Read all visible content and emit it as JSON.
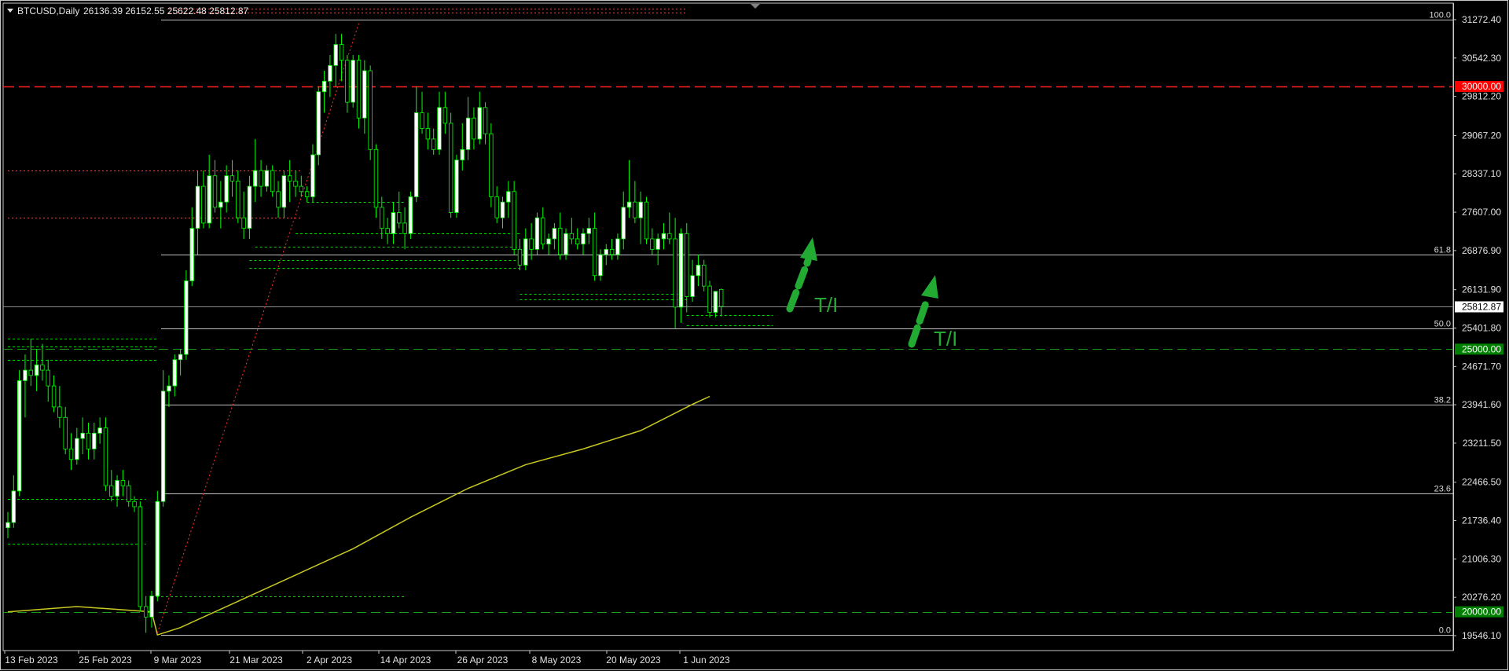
{
  "window": {
    "symbol_header": "BTCUSD,Daily",
    "ohlc_header": "26136.39 26152.55 25622.48 25812.87",
    "dropdown_icon": "triangle-down-icon"
  },
  "colors": {
    "background": "#000000",
    "frame": "#c8c8c8",
    "bull_candle": "#ffffff",
    "bear_candle": "#000000",
    "candle_outline": "#00ff00",
    "fib_lines": "#c0c0c0",
    "support_dashes": "#00ff00",
    "resistance_dashes": "#ff4040",
    "moving_average": "#c8c820",
    "arrows": "#22aa33",
    "price_label_red": "#ff0000",
    "price_label_green": "#008000",
    "current_price_label": "#ffffff"
  },
  "chart_data": {
    "type": "candlestick",
    "symbol": "BTCUSD",
    "timeframe": "Daily",
    "ylim": [
      19300,
      31500
    ],
    "y_ticks": [
      "31272.40",
      "30542.30",
      "29812.20",
      "29067.20",
      "28337.10",
      "27607.00",
      "26876.90",
      "26131.90",
      "25401.80",
      "24671.70",
      "23941.60",
      "23211.50",
      "22466.50",
      "21736.40",
      "21006.30",
      "20276.20",
      "19546.10"
    ],
    "x_ticks": [
      "13 Feb 2023",
      "25 Feb 2023",
      "9 Mar 2023",
      "21 Mar 2023",
      "2 Apr 2023",
      "14 Apr 2023",
      "26 Apr 2023",
      "8 May 2023",
      "20 May 2023",
      "1 Jun 2023"
    ],
    "current_price": "25812.87",
    "price_labels": [
      {
        "text": "30000.00",
        "price": 30000,
        "color": "red"
      },
      {
        "text": "25000.00",
        "price": 25000,
        "color": "green"
      },
      {
        "text": "20000.00",
        "price": 20000,
        "color": "green"
      }
    ],
    "fibonacci": {
      "high": 31270,
      "low": 19560,
      "levels": [
        {
          "label": "100.0",
          "price": 31270
        },
        {
          "label": "61.8",
          "price": 26800
        },
        {
          "label": "50.0",
          "price": 25400
        },
        {
          "label": "38.2",
          "price": 23950
        },
        {
          "label": "23.6",
          "price": 22250
        },
        {
          "label": "0.0",
          "price": 19560
        }
      ]
    },
    "horizontal_levels": [
      30000,
      25000,
      20000
    ],
    "annotations": [
      "T/I",
      "T/I"
    ],
    "candles": [
      [
        21600,
        21900,
        21400,
        21700
      ],
      [
        21700,
        22600,
        21600,
        22300
      ],
      [
        22300,
        24600,
        22200,
        24400
      ],
      [
        24400,
        24900,
        23700,
        24600
      ],
      [
        24600,
        25200,
        24300,
        24500
      ],
      [
        24500,
        25000,
        24200,
        24700
      ],
      [
        24700,
        25100,
        24400,
        24600
      ],
      [
        24600,
        24800,
        24000,
        24300
      ],
      [
        24300,
        24500,
        23800,
        23900
      ],
      [
        23900,
        24300,
        23500,
        23700
      ],
      [
        23700,
        23900,
        23000,
        23100
      ],
      [
        23100,
        23400,
        22700,
        22900
      ],
      [
        22900,
        23500,
        22800,
        23300
      ],
      [
        23300,
        23700,
        23000,
        23400
      ],
      [
        23400,
        23600,
        22900,
        23100
      ],
      [
        23100,
        23600,
        22900,
        23400
      ],
      [
        23400,
        23700,
        23200,
        23500
      ],
      [
        23500,
        23700,
        22300,
        22400
      ],
      [
        22400,
        22700,
        22100,
        22200
      ],
      [
        22200,
        22600,
        22000,
        22500
      ],
      [
        22500,
        22700,
        22200,
        22400
      ],
      [
        22400,
        22500,
        22000,
        22100
      ],
      [
        22100,
        22200,
        21900,
        22000
      ],
      [
        22000,
        22100,
        20000,
        20100
      ],
      [
        20100,
        20300,
        19600,
        19900
      ],
      [
        19900,
        20400,
        19700,
        20300
      ],
      [
        20300,
        22300,
        20200,
        22100
      ],
      [
        22100,
        24600,
        22000,
        24200
      ],
      [
        24200,
        24500,
        23900,
        24300
      ],
      [
        24300,
        24900,
        24100,
        24800
      ],
      [
        24800,
        25000,
        24500,
        24900
      ],
      [
        24900,
        26500,
        24800,
        26300
      ],
      [
        26300,
        27700,
        26200,
        27300
      ],
      [
        27300,
        28400,
        26800,
        28100
      ],
      [
        28100,
        28400,
        27300,
        27400
      ],
      [
        27400,
        28700,
        27300,
        28300
      ],
      [
        28300,
        28600,
        27600,
        27700
      ],
      [
        27700,
        28200,
        27300,
        27800
      ],
      [
        27800,
        28500,
        27600,
        28300
      ],
      [
        28300,
        28600,
        27900,
        28200
      ],
      [
        28200,
        28400,
        27400,
        27500
      ],
      [
        27500,
        28000,
        27100,
        27300
      ],
      [
        27300,
        28300,
        27100,
        28100
      ],
      [
        28100,
        29000,
        27800,
        28400
      ],
      [
        28400,
        28600,
        27900,
        28100
      ],
      [
        28100,
        28500,
        28000,
        28400
      ],
      [
        28400,
        28500,
        27900,
        28000
      ],
      [
        28000,
        28200,
        27500,
        27700
      ],
      [
        27700,
        28400,
        27500,
        28300
      ],
      [
        28300,
        28600,
        27800,
        28200
      ],
      [
        28200,
        28400,
        27900,
        28100
      ],
      [
        28100,
        28300,
        27900,
        28000
      ],
      [
        28000,
        28100,
        27800,
        27900
      ],
      [
        27900,
        28900,
        27800,
        28700
      ],
      [
        28700,
        30000,
        28500,
        29900
      ],
      [
        29900,
        30300,
        29500,
        30100
      ],
      [
        30100,
        30600,
        29800,
        30400
      ],
      [
        30400,
        31000,
        30000,
        30800
      ],
      [
        30800,
        31000,
        30100,
        30500
      ],
      [
        30500,
        30600,
        29500,
        29700
      ],
      [
        29700,
        30600,
        29600,
        30500
      ],
      [
        30500,
        30600,
        29200,
        29400
      ],
      [
        29400,
        30500,
        29100,
        30300
      ],
      [
        30300,
        30400,
        28600,
        28800
      ],
      [
        28800,
        28900,
        27500,
        27700
      ],
      [
        27700,
        27900,
        27100,
        27300
      ],
      [
        27300,
        27500,
        27000,
        27200
      ],
      [
        27200,
        27800,
        27000,
        27600
      ],
      [
        27600,
        28000,
        27300,
        27400
      ],
      [
        27400,
        27700,
        26900,
        27200
      ],
      [
        27200,
        28000,
        27100,
        27900
      ],
      [
        27900,
        30000,
        27800,
        29500
      ],
      [
        29500,
        29900,
        29100,
        29200
      ],
      [
        29200,
        29500,
        28800,
        29000
      ],
      [
        29000,
        29200,
        28700,
        28800
      ],
      [
        28800,
        29900,
        28700,
        29600
      ],
      [
        29600,
        29900,
        29100,
        29300
      ],
      [
        29300,
        29500,
        27500,
        27600
      ],
      [
        27600,
        28700,
        27500,
        28600
      ],
      [
        28600,
        29300,
        28400,
        28800
      ],
      [
        28800,
        29800,
        28600,
        29400
      ],
      [
        29400,
        29600,
        28800,
        29000
      ],
      [
        29000,
        29900,
        28900,
        29600
      ],
      [
        29600,
        29700,
        28900,
        29100
      ],
      [
        29100,
        29300,
        27700,
        27900
      ],
      [
        27900,
        28100,
        27400,
        27500
      ],
      [
        27500,
        27900,
        27300,
        27800
      ],
      [
        27800,
        28200,
        27500,
        28000
      ],
      [
        28000,
        28200,
        26800,
        26900
      ],
      [
        26900,
        27100,
        26500,
        26600
      ],
      [
        26600,
        27300,
        26500,
        27100
      ],
      [
        27100,
        27400,
        26700,
        26900
      ],
      [
        26900,
        27600,
        26800,
        27500
      ],
      [
        27500,
        27700,
        26900,
        27000
      ],
      [
        27000,
        27200,
        26800,
        27100
      ],
      [
        27100,
        27400,
        26900,
        27300
      ],
      [
        27300,
        27600,
        26700,
        26800
      ],
      [
        26800,
        27300,
        26700,
        27200
      ],
      [
        27200,
        27500,
        27000,
        27100
      ],
      [
        27100,
        27300,
        26900,
        27000
      ],
      [
        27000,
        27300,
        26800,
        27200
      ],
      [
        27200,
        27500,
        27000,
        27300
      ],
      [
        27300,
        27600,
        26300,
        26400
      ],
      [
        26400,
        26900,
        26300,
        26800
      ],
      [
        26800,
        27000,
        26600,
        26900
      ],
      [
        26900,
        27100,
        26700,
        26800
      ],
      [
        26800,
        27200,
        26700,
        27100
      ],
      [
        27100,
        28000,
        26900,
        27700
      ],
      [
        27700,
        28600,
        27500,
        27800
      ],
      [
        27800,
        28200,
        27400,
        27500
      ],
      [
        27500,
        28000,
        27000,
        27800
      ],
      [
        27800,
        27900,
        27000,
        27100
      ],
      [
        27100,
        27300,
        26800,
        26900
      ],
      [
        26900,
        27200,
        26600,
        27100
      ],
      [
        27100,
        27400,
        26900,
        27200
      ],
      [
        27200,
        27600,
        27000,
        27100
      ],
      [
        27100,
        27500,
        25400,
        25800
      ],
      [
        25800,
        27300,
        25500,
        27200
      ],
      [
        27200,
        27400,
        25700,
        26000
      ],
      [
        26000,
        26700,
        25900,
        26400
      ],
      [
        26400,
        26800,
        26200,
        26600
      ],
      [
        26600,
        26700,
        26100,
        26200
      ],
      [
        26200,
        26300,
        25600,
        25700
      ],
      [
        25700,
        26100,
        25600,
        26100
      ],
      [
        26136.39,
        26152.55,
        25622.48,
        25812.87
      ]
    ],
    "moving_average": [
      [
        0,
        20000
      ],
      [
        12,
        20100
      ],
      [
        25,
        20000
      ],
      [
        26,
        19560
      ],
      [
        30,
        19700
      ],
      [
        40,
        20200
      ],
      [
        50,
        20700
      ],
      [
        60,
        21200
      ],
      [
        70,
        21800
      ],
      [
        80,
        22350
      ],
      [
        90,
        22800
      ],
      [
        100,
        23100
      ],
      [
        110,
        23450
      ],
      [
        119,
        23950
      ],
      [
        122,
        24100
      ]
    ],
    "support_dashes": [
      {
        "price": 25200,
        "from": 0,
        "to": 26
      },
      {
        "price": 25050,
        "from": 0,
        "to": 26
      },
      {
        "price": 24800,
        "from": 0,
        "to": 26
      },
      {
        "price": 22150,
        "from": 0,
        "to": 24
      },
      {
        "price": 21300,
        "from": 0,
        "to": 24
      },
      {
        "price": 20300,
        "from": 25,
        "to": 69
      },
      {
        "price": 27800,
        "from": 52,
        "to": 69
      },
      {
        "price": 27200,
        "from": 50,
        "to": 89
      },
      {
        "price": 26950,
        "from": 43,
        "to": 89
      },
      {
        "price": 26700,
        "from": 42,
        "to": 89
      },
      {
        "price": 26550,
        "from": 42,
        "to": 89
      },
      {
        "price": 26050,
        "from": 89,
        "to": 118
      },
      {
        "price": 25950,
        "from": 89,
        "to": 118
      },
      {
        "price": 25650,
        "from": 118,
        "to": 133
      },
      {
        "price": 25450,
        "from": 118,
        "to": 133
      }
    ],
    "resistance_dashes": [
      {
        "price": 28400,
        "from": 0,
        "to": 51
      },
      {
        "price": 27500,
        "from": 0,
        "to": 51
      },
      {
        "price": 31480,
        "from": 28,
        "to": 118
      },
      {
        "price": 31400,
        "from": 28,
        "to": 118
      }
    ],
    "trend_line": {
      "from": [
        26,
        19600
      ],
      "to": [
        61,
        31200
      ]
    }
  }
}
